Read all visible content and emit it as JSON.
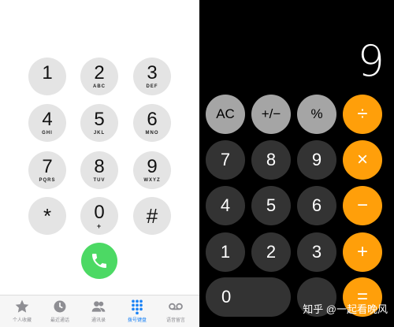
{
  "dialer": {
    "keys": [
      {
        "digit": "1",
        "letters": ""
      },
      {
        "digit": "2",
        "letters": "ABC"
      },
      {
        "digit": "3",
        "letters": "DEF"
      },
      {
        "digit": "4",
        "letters": "GHI"
      },
      {
        "digit": "5",
        "letters": "JKL"
      },
      {
        "digit": "6",
        "letters": "MNO"
      },
      {
        "digit": "7",
        "letters": "PQRS"
      },
      {
        "digit": "8",
        "letters": "TUV"
      },
      {
        "digit": "9",
        "letters": "WXYZ"
      },
      {
        "digit": "*",
        "letters": ""
      },
      {
        "digit": "0",
        "letters": "+"
      },
      {
        "digit": "#",
        "letters": ""
      }
    ],
    "call_icon": "phone-icon",
    "call_color": "#4cd964"
  },
  "tabbar": {
    "active_color": "#1a82f5",
    "items": [
      {
        "label": "个人收藏",
        "icon": "star-icon"
      },
      {
        "label": "最近通话",
        "icon": "clock-icon"
      },
      {
        "label": "通讯录",
        "icon": "contacts-icon"
      },
      {
        "label": "拨号键盘",
        "icon": "keypad-icon",
        "active": true
      },
      {
        "label": "语音留言",
        "icon": "voicemail-icon"
      }
    ]
  },
  "calculator": {
    "display": "9",
    "keys": {
      "ac": "AC",
      "plus_minus": "+/−",
      "percent": "%",
      "divide": "÷",
      "multiply": "×",
      "minus": "−",
      "plus": "+",
      "equals": "=",
      "d7": "7",
      "d8": "8",
      "d9": "9",
      "d4": "4",
      "d5": "5",
      "d6": "6",
      "d1": "1",
      "d2": "2",
      "d3": "3",
      "d0": "0",
      "decimal": ""
    },
    "colors": {
      "function": "#a5a5a5",
      "digit": "#333333",
      "operator": "#ff9f0a"
    }
  },
  "watermark": "知乎 @一起看晚风"
}
